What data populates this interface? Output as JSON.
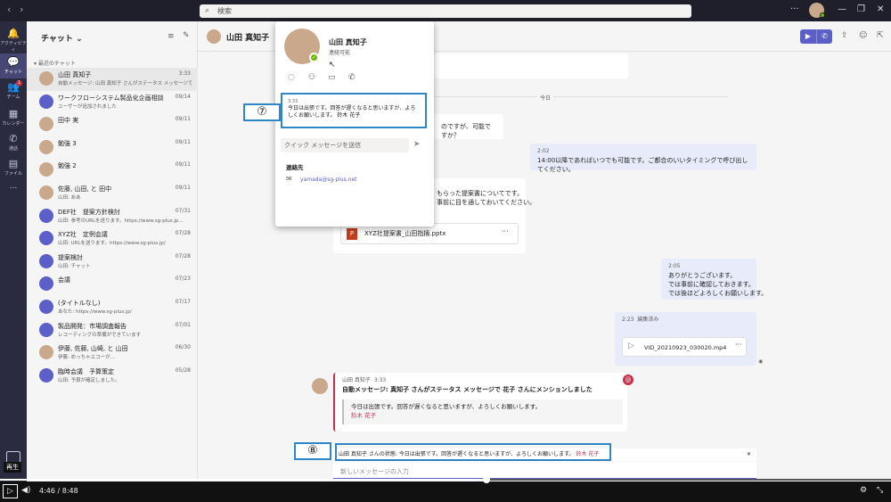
{
  "search": {
    "placeholder": "検索"
  },
  "rail": [
    {
      "label": "アクティビティ",
      "icon": "bell-icon"
    },
    {
      "label": "チャット",
      "icon": "chat-icon"
    },
    {
      "label": "チーム",
      "icon": "teams-icon",
      "badge": "1"
    },
    {
      "label": "カレンダー",
      "icon": "calendar-icon"
    },
    {
      "label": "通話",
      "icon": "phone-icon"
    },
    {
      "label": "ファイル",
      "icon": "file-icon"
    },
    {
      "label": "...",
      "icon": "more-icon"
    }
  ],
  "chatlist": {
    "title": "チャット",
    "recent": "最近のチャット",
    "items": [
      {
        "name": "山田 真知子",
        "preview": "自動メッセージ: 山田 真知子 さんがステータス メッセージで 花…",
        "date": "3:33"
      },
      {
        "name": "ワークフローシステム製品化企画相談",
        "preview": "ユーザーが追加されました",
        "date": "09/14"
      },
      {
        "name": "田中 実",
        "preview": "",
        "date": "09/11"
      },
      {
        "name": "勉強 3",
        "preview": "",
        "date": "09/11"
      },
      {
        "name": "勉強 2",
        "preview": "",
        "date": "09/11"
      },
      {
        "name": "佐藤, 山田, と 田中",
        "preview": "山田: ああ",
        "date": "09/11"
      },
      {
        "name": "DEF社　提案方針検討",
        "preview": "山田: 参考のURLを送ります。https://www.sg-plus.jp…",
        "date": "07/31"
      },
      {
        "name": "XYZ社　定例会議",
        "preview": "山田: URLを送ります。https://www.sg-plus.jp/",
        "date": "07/28"
      },
      {
        "name": "提案検討",
        "preview": "山田: チャット",
        "date": "07/28"
      },
      {
        "name": "会議",
        "preview": "",
        "date": "07/23"
      },
      {
        "name": "(タイトルなし)",
        "preview": "あなた: https://www.sg-plus.jp/",
        "date": "07/17"
      },
      {
        "name": "製品開発：市場調査報告",
        "preview": "レコーディングの準備ができています",
        "date": "07/01"
      },
      {
        "name": "伊藤, 佐藤, 山崎, と 山田",
        "preview": "伊藤: めっちゃエコーが…",
        "date": "06/30"
      },
      {
        "name": "臨時会議　予算策定",
        "preview": "山田: 予算が確定しました。",
        "date": "05/28"
      }
    ]
  },
  "header": {
    "name": "山田 真知子"
  },
  "card": {
    "name": "山田 真知子",
    "status": "連絡可能",
    "time": "3:33",
    "message": "今日は出張です。回答が遅くなると思いますが、よろしくお願いします。 鈴木 花子",
    "quick_placeholder": "クイック メッセージを送信",
    "contact_label": "連絡先",
    "email": "yamada@sg-plus.net"
  },
  "conv": {
    "date_sep": "今日",
    "msg1": "のですが、可能ですか？",
    "msg2_time": "2:02",
    "msg2": "14:00以降であればいつでも可能です。ご都合のいいタイミングで呼び出してください。",
    "msg3a": "もらった提案書についてです。",
    "msg3b": "事前に目を通しておいてください。",
    "file1": "XYZ社提案書_山田指摘.pptx",
    "msg4_time": "2:05",
    "msg4a": "ありがとうございます。",
    "msg4b": "では事前に確認しておきます。",
    "msg4c": "では後ほどよろしくお願いします。",
    "msg5_time": "2:23",
    "msg5_edit": "編集済み",
    "file2": "VID_20210923_030020.mp4",
    "auto_name": "山田 真知子",
    "auto_time": "3:33",
    "auto_title": "自動メッセージ: 真知子 さんがステータス メッセージで 花子 さんにメンションしました",
    "auto_quote": "今日は出張です。回答が遅くなると思いますが、よろしくお願いします。",
    "auto_mention": "鈴木 花子"
  },
  "status_bar": {
    "prefix": "山田 真知子 さんの状態: 今日は出張です。回答が遅くなると思いますが、よろしくお願いします。",
    "mention": "鈴木 花子"
  },
  "compose": {
    "placeholder": "新しいメッセージの入力"
  },
  "callouts": {
    "c7": "⑦",
    "c8": "⑧"
  },
  "replay_label": "再生",
  "player": {
    "current": "4:46",
    "total": "8:48",
    "progress": 0.546
  }
}
